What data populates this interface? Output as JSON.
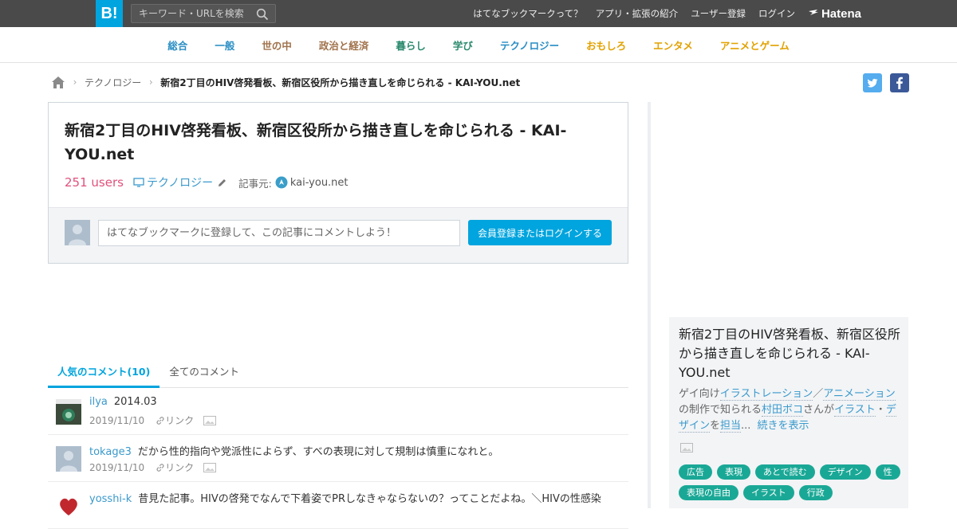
{
  "header": {
    "logo": "B!",
    "search_placeholder": "キーワード・URLを検索",
    "links": [
      "はてなブックマークって？",
      "アプリ・拡張の紹介",
      "ユーザー登録",
      "ログイン"
    ],
    "brand": "Hatena"
  },
  "categories": [
    {
      "label": "総合",
      "color": "#2a8ec4"
    },
    {
      "label": "一般",
      "color": "#2a8ec4"
    },
    {
      "label": "世の中",
      "color": "#a0724b"
    },
    {
      "label": "政治と経済",
      "color": "#a0724b"
    },
    {
      "label": "暮らし",
      "color": "#2b8a6e"
    },
    {
      "label": "学び",
      "color": "#2b8a6e"
    },
    {
      "label": "テクノロジー",
      "color": "#2a8ec4"
    },
    {
      "label": "おもしろ",
      "color": "#e2a100"
    },
    {
      "label": "エンタメ",
      "color": "#e2a100"
    },
    {
      "label": "アニメとゲーム",
      "color": "#e2a100"
    }
  ],
  "breadcrumb": {
    "category": "テクノロジー",
    "title": "新宿2丁目のHIV啓発看板、新宿区役所から描き直しを命じられる - KAI-YOU.net"
  },
  "entry": {
    "title": "新宿2丁目のHIV啓発看板、新宿区役所から描き直しを命じられる - KAI-YOU.net",
    "users": "251 users",
    "category": "テクノロジー",
    "source_label": "記事元:",
    "source": "kai-you.net"
  },
  "comment_form": {
    "placeholder": "はてなブックマークに登録して、この記事にコメントしよう！",
    "button": "会員登録またはログインする"
  },
  "tabs": {
    "popular": "人気のコメント(10)",
    "all": "全てのコメント"
  },
  "comments": [
    {
      "user": "ilya",
      "text": "2014.03",
      "date": "2019/11/10",
      "link": "リンク",
      "avatar": "#5b7a5e"
    },
    {
      "user": "tokage3",
      "text": "だから性的指向や党派性によらず、すべの表現に対して規制は慎重になれと。",
      "date": "2019/11/10",
      "link": "リンク",
      "avatar": "#aebdcc"
    },
    {
      "user": "yosshi-k",
      "text": "昔見た記事。HIVの啓発でなんで下着姿でPRしなきゃならないの？ってことだよね。＼HIVの性感染",
      "date": "",
      "link": "",
      "avatar": "#c0282d"
    }
  ],
  "sidebar": {
    "title": "新宿2丁目のHIV啓発看板、新宿区役所から描き直しを命じられる - KAI-YOU.net",
    "desc_1": "ゲイ向け",
    "kw_1": "イラストレーション",
    "desc_2": "／",
    "kw_2": "アニメーション",
    "desc_3": "の制作で知られる",
    "kw_3": "村田ボコ",
    "desc_4": "さんが",
    "kw_4": "イラスト",
    "desc_5": "・",
    "kw_5": "デザイン",
    "desc_6": "を",
    "kw_6": "担当",
    "desc_7": "...",
    "more": "続きを表示",
    "tags": [
      "広告",
      "表現",
      "あとで読む",
      "デザイン",
      "性",
      "表現の自由",
      "イラスト",
      "行政"
    ]
  }
}
